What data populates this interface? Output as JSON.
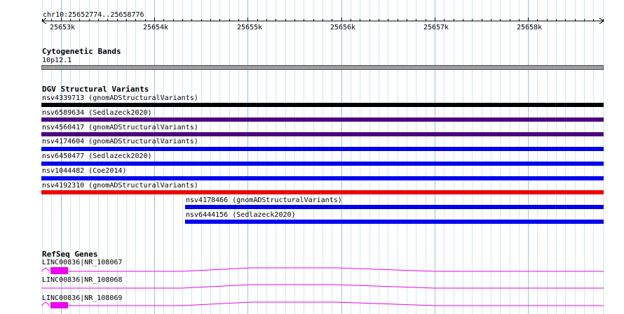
{
  "ruler": {
    "region": "chr10:25652774..25658776",
    "ticks": [
      "25653k",
      "25654k",
      "25655k",
      "25656k",
      "25657k",
      "25658k"
    ]
  },
  "cytoband": {
    "title": "Cytogenetic Bands",
    "band": "10p12.1",
    "color": "#9c9c9c"
  },
  "dgv": {
    "title": "DGV Structural Variants",
    "variants": [
      {
        "label": "nsv4339713 (gnomADStructuralVariants)",
        "color": "#000000"
      },
      {
        "label": "nsv6589634 (Sedlazeck2020)",
        "color": "#4b0082"
      },
      {
        "label": "nsv4560417 (gnomADStructuralVariants)",
        "color": "#4b0082"
      },
      {
        "label": "nsv4174604 (gnomADStructuralVariants)",
        "color": "#0000ee"
      },
      {
        "label": "nsv6450477 (Sedlazeck2020)",
        "color": "#0000ee"
      },
      {
        "label": "nsv1044482 (Coe2014)",
        "color": "#0000ee"
      },
      {
        "label": "nsv4192310 (gnomADStructuralVariants)",
        "color": "#ee0000"
      },
      {
        "label": "nsv4178466 (gnomADStructuralVariants)",
        "color": "#0000ee"
      },
      {
        "label": "nsv6444156 (Sedlazeck2020)",
        "color": "#0000ee"
      }
    ]
  },
  "refseq": {
    "title": "RefSeq Genes",
    "color": "#ee00ee",
    "transcripts": [
      {
        "label": "LINC00836|NR_108067"
      },
      {
        "label": "LINC00836|NR_108068"
      },
      {
        "label": "LINC00836|NR_108069"
      }
    ]
  }
}
